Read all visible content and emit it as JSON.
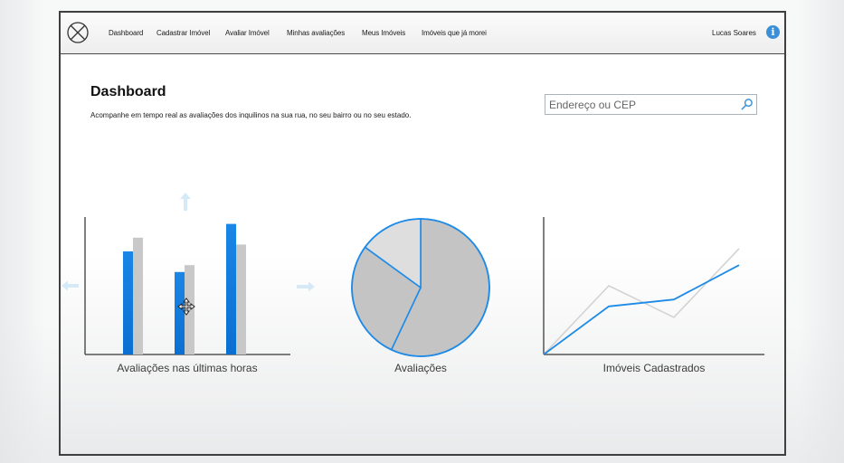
{
  "topbar": {
    "logo_icon": "circle-x-logo-icon",
    "nav": [
      {
        "label": "Dashboard"
      },
      {
        "label": "Cadastrar Imóvel"
      },
      {
        "label": "Avaliar Imóvel"
      },
      {
        "label": "Minhas avaliações"
      },
      {
        "label": "Meus Imóveis"
      },
      {
        "label": "Imóveis que já morei"
      }
    ],
    "user_name": "Lucas Soares",
    "info_icon": "info-icon",
    "info_glyph": "i"
  },
  "page": {
    "title": "Dashboard",
    "subtitle": "Acompanhe em tempo real as avaliações dos inquilinos na sua rua, no seu bairro ou no seu estado."
  },
  "search": {
    "placeholder": "Endereço ou CEP",
    "icon": "search-icon"
  },
  "colors": {
    "accent_blue": "#1e8be8",
    "bar_gray": "#c8c8c8",
    "pie_fill": "#c4c4c4",
    "pie_light": "#dedede",
    "line_gray": "#d3d3d3"
  },
  "chart_data": [
    {
      "type": "bar",
      "title": "Avaliações nas últimas horas",
      "categories": [
        "",
        "",
        ""
      ],
      "series": [
        {
          "values": [
            75,
            60,
            95
          ]
        },
        {
          "values": [
            85,
            65,
            80
          ]
        }
      ],
      "ylim": [
        0,
        100
      ]
    },
    {
      "type": "pie",
      "title": "Avaliações",
      "values": [
        57,
        28,
        15
      ]
    },
    {
      "type": "line",
      "title": "Imóveis Cadastrados",
      "x": [
        0,
        1,
        2,
        3
      ],
      "series": [
        {
          "values": [
            0,
            35,
            40,
            65
          ]
        },
        {
          "values": [
            0,
            50,
            27,
            77
          ]
        }
      ],
      "ylim": [
        0,
        100
      ]
    }
  ]
}
